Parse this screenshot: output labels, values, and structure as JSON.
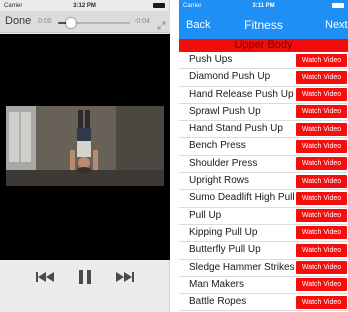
{
  "video_screen": {
    "status": {
      "carrier": "Carrier",
      "time": "3:12 PM"
    },
    "player": {
      "done_label": "Done",
      "elapsed": "0:00",
      "remaining": "-0:04",
      "progress": 0.18
    },
    "controls": [
      "rewind-icon",
      "pause-icon",
      "fast-forward-icon"
    ]
  },
  "fitness_screen": {
    "status": {
      "carrier": "Carrier",
      "time": "3:11 PM"
    },
    "nav": {
      "back_label": "Back",
      "title": "Fitness",
      "next_label": "Next"
    },
    "section_title": "Upper Body",
    "watch_label": "Watch Video",
    "exercises": [
      "Push Ups",
      "Diamond Push Up",
      "Hand Release Push Up",
      "Sprawl Push Up",
      "Hand Stand Push Up",
      "Bench Press",
      "Shoulder Press",
      "Upright Rows",
      "Sumo Deadlift High Pull",
      "Pull Up",
      "Kipping Pull Up",
      "Butterfly Pull Up",
      "Sledge Hammer Strikes",
      "Man Makers",
      "Battle Ropes"
    ]
  },
  "colors": {
    "accent_blue": "#1e8ff5",
    "accent_red": "#f20d0d",
    "player_bar": "#dcdcdc",
    "video_bg": "#000000"
  }
}
